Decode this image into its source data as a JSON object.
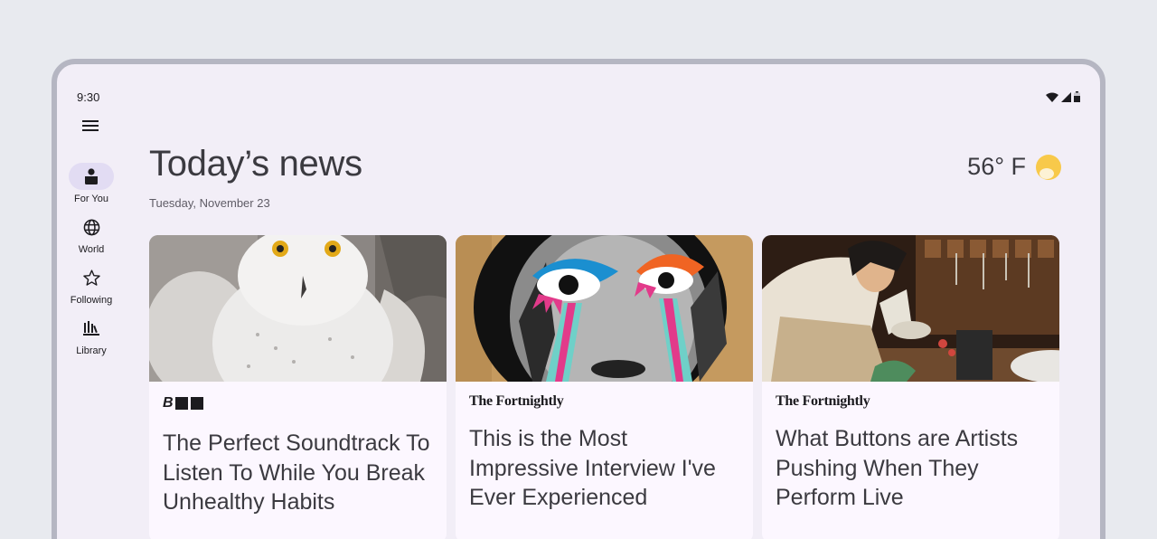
{
  "status": {
    "time": "9:30"
  },
  "nav": {
    "items": [
      {
        "label": "For You",
        "icon": "for-you-icon",
        "active": true
      },
      {
        "label": "World",
        "icon": "globe-icon",
        "active": false
      },
      {
        "label": "Following",
        "icon": "star-icon",
        "active": false
      },
      {
        "label": "Library",
        "icon": "library-icon",
        "active": false
      }
    ]
  },
  "header": {
    "title": "Today’s news",
    "date": "Tuesday, November 23"
  },
  "weather": {
    "temperature": "56° F",
    "icon": "partly-sunny-icon"
  },
  "colors": {
    "background": "#e8eaef",
    "surface": "#f2eef7",
    "card": "#fcf7ff",
    "nav_active": "#e2dcf3",
    "sun": "#f8c94a"
  },
  "cards": [
    {
      "publisher": "B",
      "publisher_logo": "block-logo",
      "headline": "The Perfect Soundtrack To Listen To While You Break Unhealthy Habits",
      "image": "snowy-owl"
    },
    {
      "publisher": "The Fortnightly",
      "headline": "This is the Most Impressive Interview I've Ever Experienced",
      "image": "collage-face-with-painted-eyes"
    },
    {
      "publisher": "The Fortnightly",
      "headline": "What Buttons are Artists Pushing When They Perform Live",
      "image": "baker-piping-cream"
    }
  ]
}
